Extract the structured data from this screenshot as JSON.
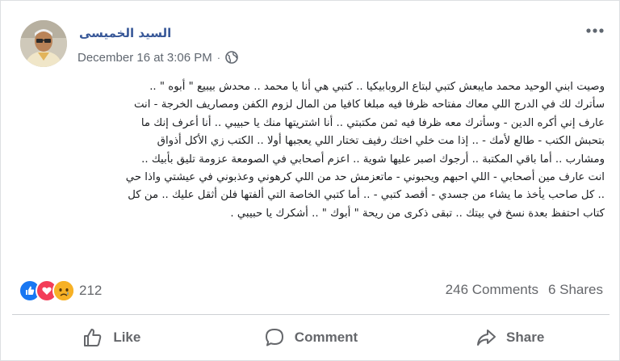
{
  "post": {
    "author": "السيد الخميسى",
    "timestamp": "December 16 at 3:06 PM",
    "separator": "·",
    "body": "وصيت ابني الوحيد محمد مايبعش كتبي لبتاع الروبابيكيا .. كتبي هي أنا يا محمد .. محدش بيبيع \" أبوه \" ..\nسأترك لك في الدرج اللي معاك مفتاحه ظرفا فيه مبلغا كافيا من المال لزوم الكفن ومصاريف الخرجة - انت\nعارف إني أكره الدين - وسأترك معه ظرفا فيه ثمن مكتبتي .. أنا اشتريتها منك يا حبيبي .. أنا أعرف إنك ما\nبتحبش الكتب - طالع لأمك - .. إذا مت خلي اختك رفيف تختار اللي يعجبها أولا .. الكتب زي الأكل أذواق\nومشارب .. أما باقي المكتبة .. أرجوك اصبر عليها شوية .. اعزم أصحابي في الصومعة عزومة تليق بأبيك ..\nانت عارف مين أصحابي - اللي احبهم ويحبوني - ماتعزمش حد من اللي كرهوني وعذبوني في عيشتي واذا حي\n.. كل صاحب يأخذ ما يشاء من جسدي - أقصد كتبي - .. أما كتبي الخاصة التي ألفتها فلن أثقل عليك .. من كل\nكتاب احتفظ بعدة نسخ في بيتك .. تبقى ذكرى من ريحة \" أبوك \" .. أشكرك يا حبيبي ."
  },
  "reactions": {
    "count": "212",
    "icons": [
      "like-reaction",
      "love-reaction",
      "sad-reaction"
    ],
    "comments": "246 Comments",
    "shares": "6 Shares"
  },
  "actions": {
    "like": "Like",
    "comment": "Comment",
    "share": "Share"
  },
  "colors": {
    "author_link": "#385898",
    "like_blue": "#1877f2",
    "love_red": "#f33e58",
    "sad_yellow": "#f7b125",
    "muted_text": "#65676b"
  }
}
